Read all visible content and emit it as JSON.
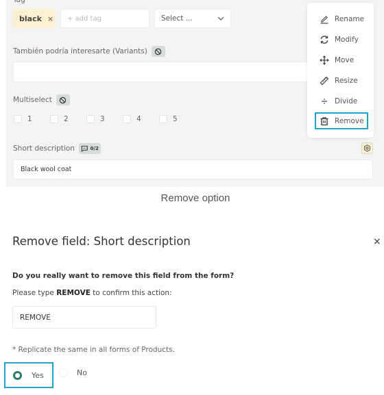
{
  "form": {
    "tag_field": {
      "label": "Tag",
      "tags": [
        {
          "label": "black",
          "remove_icon": "×"
        }
      ],
      "add_placeholder": "+ add tag",
      "select_value": "Select ..."
    },
    "variants_field": {
      "label": "También podría interesarte (Variants)",
      "badge_icon": "ban-icon"
    },
    "multiselect_field": {
      "label": "Multiselect",
      "badge_icon": "ban-icon",
      "options": [
        {
          "label": "1",
          "checked": false
        },
        {
          "label": "2",
          "checked": false
        },
        {
          "label": "3",
          "checked": false
        },
        {
          "label": "4",
          "checked": false
        },
        {
          "label": "5",
          "checked": false
        }
      ]
    },
    "short_description_field": {
      "label": "Short description",
      "badge_icon": "comment-icon",
      "badge_count": "0/2",
      "value": "Black wool coat",
      "settings_icon": "gear-icon"
    }
  },
  "context_menu": {
    "items": [
      {
        "label": "Rename",
        "icon": "pencil-line-icon"
      },
      {
        "label": "Modify",
        "icon": "refresh-icon"
      },
      {
        "label": "Move",
        "icon": "move-arrows-icon"
      },
      {
        "label": "Resize",
        "icon": "ruler-icon"
      },
      {
        "label": "Divide",
        "icon": "divide-icon"
      },
      {
        "label": "Remove",
        "icon": "trash-icon",
        "highlighted": true
      }
    ]
  },
  "caption": "Remove option",
  "dialog": {
    "title": "Remove field: Short description",
    "close_icon": "×",
    "question": "Do you really want to remove this field from the form?",
    "instruction_prefix": "Please type ",
    "instruction_keyword": "REMOVE",
    "instruction_suffix": " to confirm this action:",
    "confirm_input_value": "REMOVE",
    "replicate_label": "* Replicate the same in all forms of Products.",
    "replicate_options": [
      {
        "label": "Yes",
        "selected": true
      },
      {
        "label": "No",
        "selected": false
      }
    ]
  },
  "colors": {
    "highlight_border": "#21a3c9",
    "radio_selected": "#2f7a6a",
    "tag_chip_bg": "#fbf0cf",
    "panel_bg": "#f4f4f4"
  }
}
